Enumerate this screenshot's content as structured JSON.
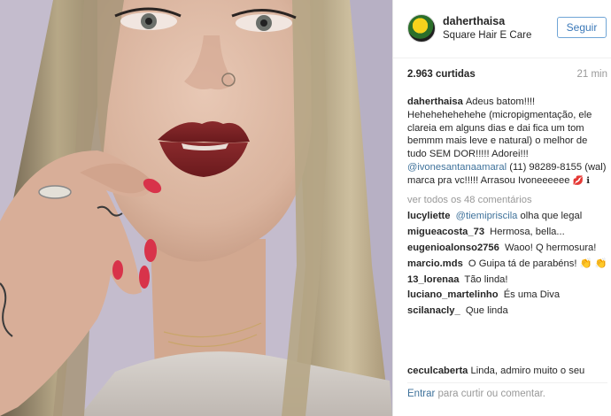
{
  "post": {
    "username": "daherthaisa",
    "location": "Square Hair E Care",
    "follow_label": "Seguir",
    "likes": "2.963 curtidas",
    "time": "21 min"
  },
  "caption": {
    "user": "daherthaisa",
    "text_1": "Adeus batom!!!! Hehehehehehehe (micropigmentação, ele clareia em alguns dias e dai fica um tom bemmm mais leve e natural) o melhor de tudo SEM DOR!!!!! Adorei!!!",
    "mention": "@ivonesantanaamaral",
    "text_2": "(11) 98289-8155 (wal) marca pra vc!!!!! Arrasou Ivoneeeeee",
    "emoji": "💋 ℹ"
  },
  "view_all": "ver todos os 48 comentários",
  "comments": [
    {
      "user": "lucyliette",
      "mention": "@tiemipriscila",
      "text": "olha que legal"
    },
    {
      "user": "migueacosta_73",
      "mention": "",
      "text": "Hermosa, bella..."
    },
    {
      "user": "eugenioalonso2756",
      "mention": "",
      "text": "Waoo! Q hermosura!"
    },
    {
      "user": "marcio.mds",
      "mention": "",
      "text": "O Guipa tá de parabéns! 👏 👏"
    },
    {
      "user": "13_lorenaa",
      "mention": "",
      "text": "Tão linda!"
    },
    {
      "user": "luciano_martelinho",
      "mention": "",
      "text": "És uma Diva"
    },
    {
      "user": "scilanacly_",
      "mention": "",
      "text": "Que linda"
    }
  ],
  "partial_comment": {
    "user": "ceculcaberta",
    "text": "Linda, admiro muito o seu"
  },
  "add_comment": {
    "enter": "Entrar",
    "rest": "para curtir ou comentar."
  },
  "colors": {
    "link": "#3f729b",
    "follow_border": "#70a5d6",
    "lip": "#7a1f22",
    "nails": "#d8334a"
  }
}
